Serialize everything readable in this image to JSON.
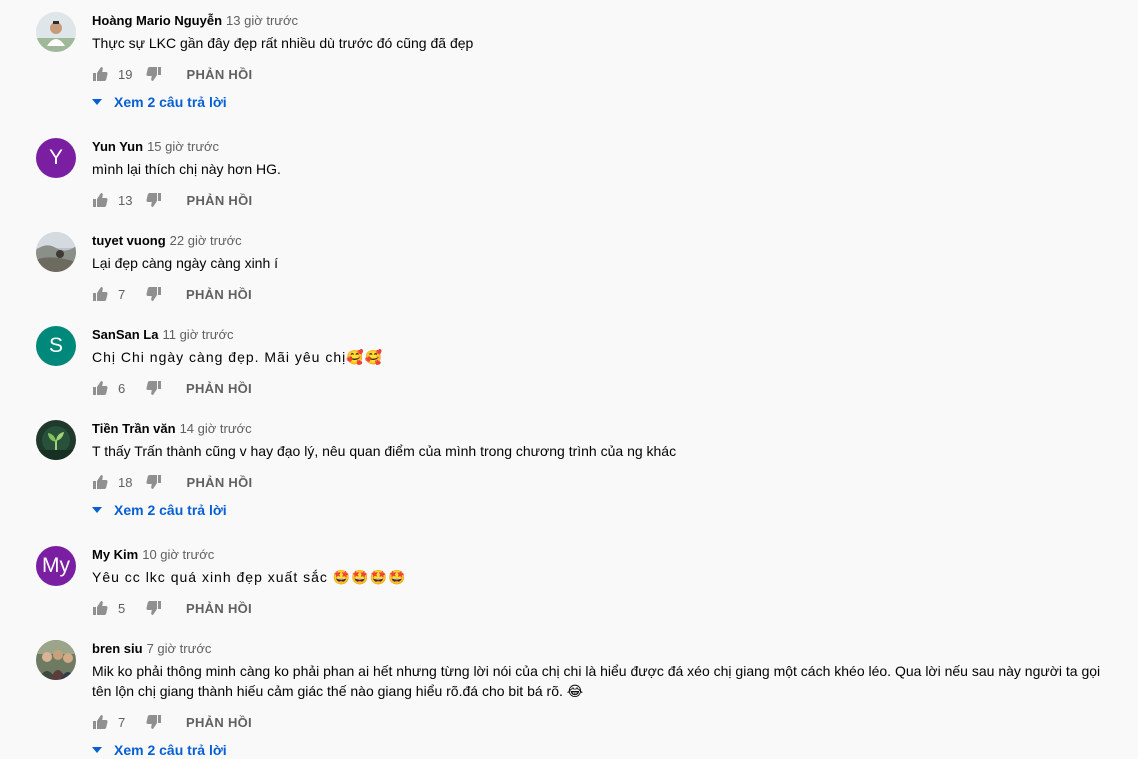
{
  "colors": {
    "background": "#f9f9f9",
    "link": "#065fd4",
    "muted": "#606060"
  },
  "comments": [
    {
      "author": "Hoàng Mario Nguyễn",
      "time": "13 giờ trước",
      "text": "Thực sự LKC gần đây đẹp rất nhiều dù trước đó cũng đã đẹp",
      "likes": "19",
      "reply_label": "PHẢN HỒI",
      "view_replies": "Xem 2 câu trả lời",
      "avatar": {
        "type": "photo",
        "icon": "person-photo"
      }
    },
    {
      "author": "Yun Yun",
      "time": "15 giờ trước",
      "text": "mình lại thích chị này hơn HG.",
      "likes": "13",
      "reply_label": "PHẢN HỒI",
      "avatar": {
        "type": "letter",
        "letter": "Y",
        "color": "#7b1fa2"
      }
    },
    {
      "author": "tuyet vuong",
      "time": "22 giờ trước",
      "text": "Lại đẹp càng ngày càng xinh í",
      "likes": "7",
      "reply_label": "PHẢN HỒI",
      "avatar": {
        "type": "photo",
        "icon": "landscape-photo"
      }
    },
    {
      "author": "SanSan La",
      "time": "11 giờ trước",
      "text": "Chị Chi ngày càng đẹp. Mãi yêu chị🥰🥰",
      "likes": "6",
      "reply_label": "PHẢN HỒI",
      "avatar": {
        "type": "letter",
        "letter": "S",
        "color": "#00897b"
      }
    },
    {
      "author": "Tiền Trần văn",
      "time": "14 giờ trước",
      "text": "T thấy Trấn thành cũng v hay đạo lý, nêu quan điểm của mình trong chương trình của ng khác",
      "likes": "18",
      "reply_label": "PHẢN HỒI",
      "view_replies": "Xem 2 câu trả lời",
      "avatar": {
        "type": "photo",
        "icon": "sprout-photo"
      }
    },
    {
      "author": "My Kim",
      "time": "10 giờ trước",
      "text": "Yêu cc lkc quá xinh đẹp xuất sắc 🤩🤩🤩🤩",
      "likes": "5",
      "reply_label": "PHẢN HỒI",
      "avatar": {
        "type": "letter",
        "letter": "My",
        "color": "#7b1fa2"
      }
    },
    {
      "author": "bren siu",
      "time": "7 giờ trước",
      "text": "Mik ko phải thông minh càng ko phải phan ai hết nhưng từng lời nói của chị chi là hiểu được đá xéo chị giang một cách khéo léo. Qua lời nếu sau này người ta gọi tên lộn chị giang thành hiếu cảm giác thế nào giang hiểu rõ.đá cho bit bá rõ. 😂",
      "likes": "7",
      "reply_label": "PHẢN HỒI",
      "view_replies": "Xem 2 câu trả lời",
      "avatar": {
        "type": "photo",
        "icon": "group-photo"
      }
    }
  ]
}
